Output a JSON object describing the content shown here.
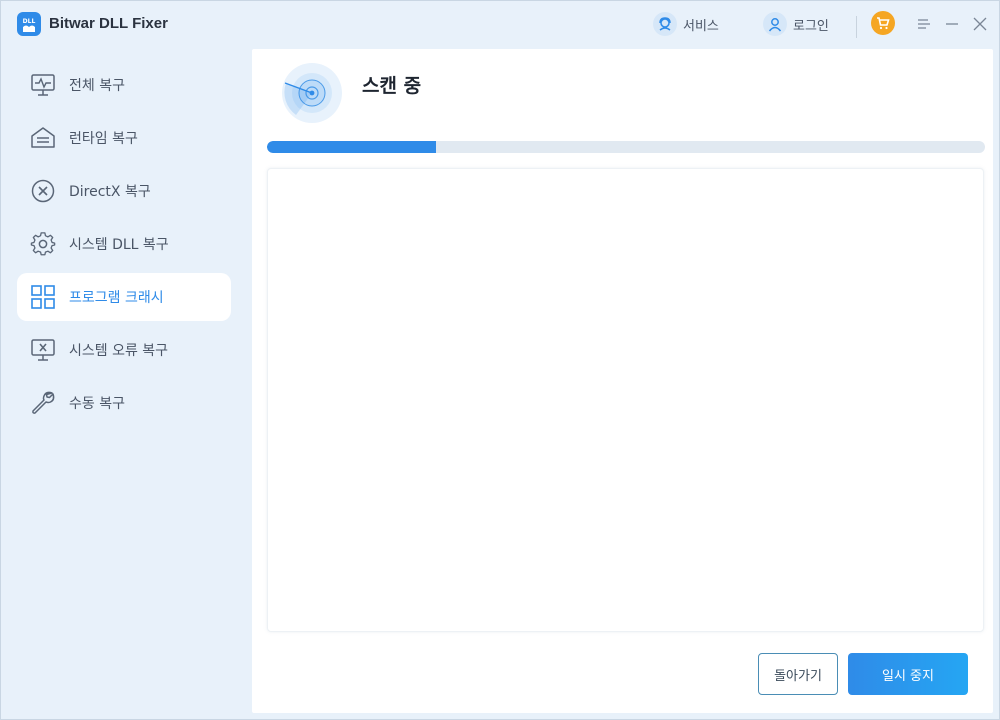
{
  "app": {
    "title": "Bitwar DLL Fixer",
    "logo_text": "DLL"
  },
  "titlebar": {
    "service_label": "서비스",
    "login_label": "로그인"
  },
  "sidebar": {
    "items": [
      {
        "label": "전체 복구",
        "icon": "monitor-pulse-icon",
        "active": false
      },
      {
        "label": "런타임 복구",
        "icon": "home-list-icon",
        "active": false
      },
      {
        "label": "DirectX 복구",
        "icon": "circle-x-icon",
        "active": false
      },
      {
        "label": "시스템 DLL 복구",
        "icon": "gear-icon",
        "active": false
      },
      {
        "label": "프로그램 크래시",
        "icon": "grid-icon",
        "active": true
      },
      {
        "label": "시스템 오류 복구",
        "icon": "monitor-x-icon",
        "active": false
      },
      {
        "label": "수동 복구",
        "icon": "wrench-icon",
        "active": false
      }
    ]
  },
  "main": {
    "title": "스캔 중",
    "progress_fraction": 0.235,
    "back_label": "돌아가기",
    "pause_label": "일시 중지"
  },
  "colors": {
    "accent": "#2f8be8",
    "sidebar_bg": "#e8f1fa",
    "cart": "#f5a623"
  }
}
